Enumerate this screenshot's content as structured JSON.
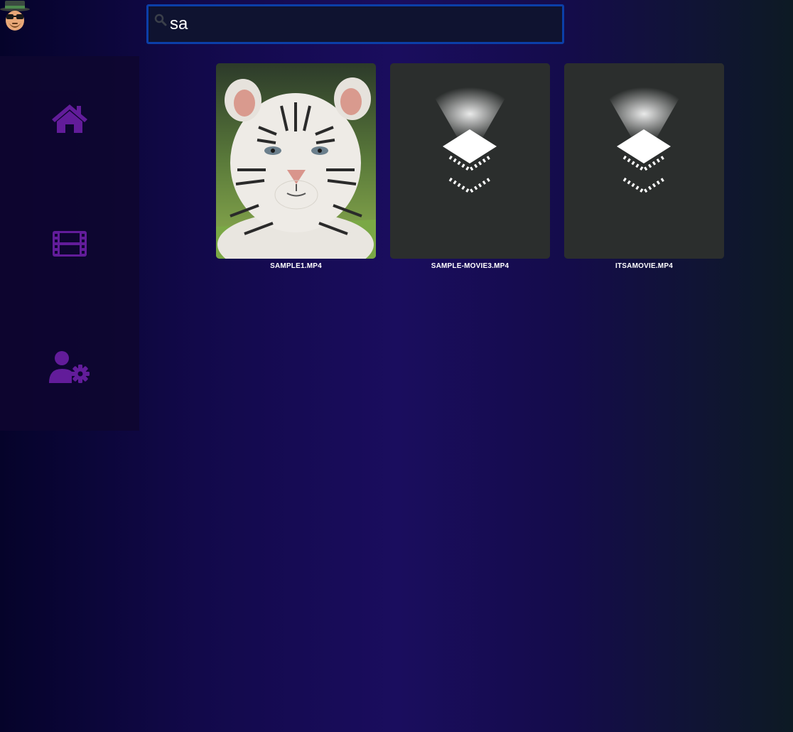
{
  "header": {
    "avatar_icon": "heisenberg-avatar-icon"
  },
  "search": {
    "icon": "search-icon",
    "value": "sa",
    "placeholder": ""
  },
  "sidebar": {
    "accent_color": "#6a1fa3",
    "items": [
      {
        "icon": "home-icon"
      },
      {
        "icon": "film-icon"
      },
      {
        "icon": "user-settings-icon"
      }
    ]
  },
  "results": [
    {
      "label": "SAMPLE1.MP4",
      "thumbnail": "white-tiger-cub-photo"
    },
    {
      "label": "SAMPLE-MOVIE3.MP4",
      "thumbnail": "default-video-icon"
    },
    {
      "label": "ITSAMOVIE.MP4",
      "thumbnail": "default-video-icon"
    }
  ]
}
